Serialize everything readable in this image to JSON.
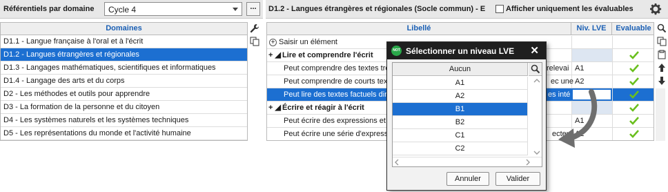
{
  "left": {
    "title": "Référentiels par domaine",
    "cycle_value": "Cycle 4",
    "dots_label": "...",
    "column_header": "Domaines",
    "domains": [
      "D1.1 - Langue française à l'oral et à l'écrit",
      "D1.2 - Langues étrangères et régionales",
      "D1.3 - Langages mathématiques, scientifiques et informatiques",
      "D1.4 - Langage des arts et du corps",
      "D2 - Les méthodes et outils pour apprendre",
      "D3 - La formation de la personne et du citoyen",
      "D4 - Les systèmes naturels et les systèmes techniques",
      "D5 - Les représentations du monde et l'activité humaine"
    ]
  },
  "right": {
    "title": "D1.2 - Langues étrangères et régionales (Socle commun) - E",
    "checkbox_label": "Afficher uniquement les évaluables",
    "headers": {
      "libelle": "Libellé",
      "niv": "Niv. LVE",
      "evaluable": "Evaluable"
    },
    "rows": [
      {
        "text": "Saisir un élément",
        "niv": "",
        "type": "add"
      },
      {
        "text": "Lire et comprendre l'écrit",
        "niv": "",
        "type": "group"
      },
      {
        "text": "Peut comprendre des textes très",
        "tail": "relevai",
        "niv": "A1",
        "type": "item"
      },
      {
        "text": "Peut comprendre de courts tex",
        "tail": "ec une",
        "niv": "A2",
        "type": "item"
      },
      {
        "text": "Peut lire des textes factuels dir",
        "tail": "es inté",
        "niv": "",
        "type": "selected"
      },
      {
        "text": "Écrire et réagir à l'écrit",
        "niv": "",
        "type": "group"
      },
      {
        "text": "Peut écrire des expressions et",
        "tail": "",
        "niv": "A1",
        "type": "item"
      },
      {
        "text": "Peut écrire une série d'express",
        "tail": "ecteur",
        "niv": "A2",
        "type": "item"
      }
    ]
  },
  "modal": {
    "logo_text": "NOT",
    "title": "Sélectionner un niveau LVE",
    "close": "✕",
    "list_header": "Aucun",
    "options": [
      "A1",
      "A2",
      "B1",
      "B2",
      "C1",
      "C2"
    ],
    "selected": "B1",
    "cancel_label": "Annuler",
    "ok_label": "Valider"
  },
  "colors": {
    "selection": "#1c6fd1",
    "header_text": "#1a5fb4",
    "check": "#6abf1e"
  }
}
